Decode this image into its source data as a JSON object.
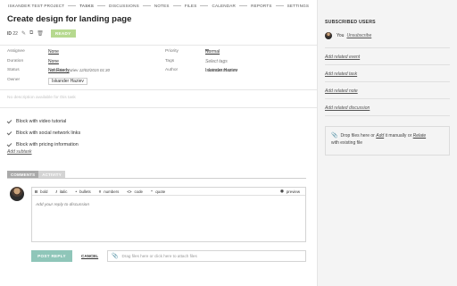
{
  "nav": {
    "items": [
      "ISKANDER TEST PROJECT",
      "TASKS",
      "DISCUSSIONS",
      "NOTES",
      "FILES",
      "CALENDAR",
      "REPORTS",
      "SETTINGS"
    ]
  },
  "task": {
    "title": "Create design for landing page",
    "id_label": "ID",
    "id_value": "22",
    "status_badge": "READY"
  },
  "props": {
    "assignee": {
      "label": "Assignee",
      "value": "None"
    },
    "duration": {
      "label": "Duration",
      "value": "None"
    },
    "status": {
      "label": "Status",
      "value": "Not Ready",
      "meta": "Iskander Haziev 12/02/2015 01:30"
    },
    "owner": {
      "label": "Owner",
      "value": "Iskander Haziev"
    },
    "priority": {
      "label": "Priority",
      "value": "Normal"
    },
    "tags": {
      "label": "Tags",
      "value": "Select tags"
    },
    "author": {
      "label": "Author",
      "value": "Iskander Haziev",
      "meta": "12/02/2015 01:30"
    }
  },
  "description_placeholder": "No description available for this task",
  "subtasks": [
    "Block with video tutorial",
    "Block with social network links",
    "Block with pricing information"
  ],
  "add_subtask": "Add subtask",
  "tabs": {
    "comments": "COMMENTS",
    "activity": "ACTIVITY"
  },
  "editor": {
    "toolbar": {
      "bold": "bold",
      "italic": "italic",
      "bullets": "bullets",
      "numbers": "numbers",
      "code": "code",
      "quote": "quote",
      "preview": "preview"
    },
    "placeholder": "Add your reply to discussion"
  },
  "actions": {
    "post": "POST REPLY",
    "cancel": "CANCEL",
    "attach_placeholder": "Drag files here or click here to attach files"
  },
  "sidebar": {
    "title": "SUBSCRIBED USERS",
    "user": "You",
    "unsubscribe": "Unsubscribe",
    "links": [
      "Add related event",
      "Add related task",
      "Add related note",
      "Add related discussion"
    ],
    "drop": {
      "before": "Drop files here or",
      "add": "Add",
      "middle": "it manually or",
      "relate": "Relate",
      "after": "with existing file"
    }
  }
}
